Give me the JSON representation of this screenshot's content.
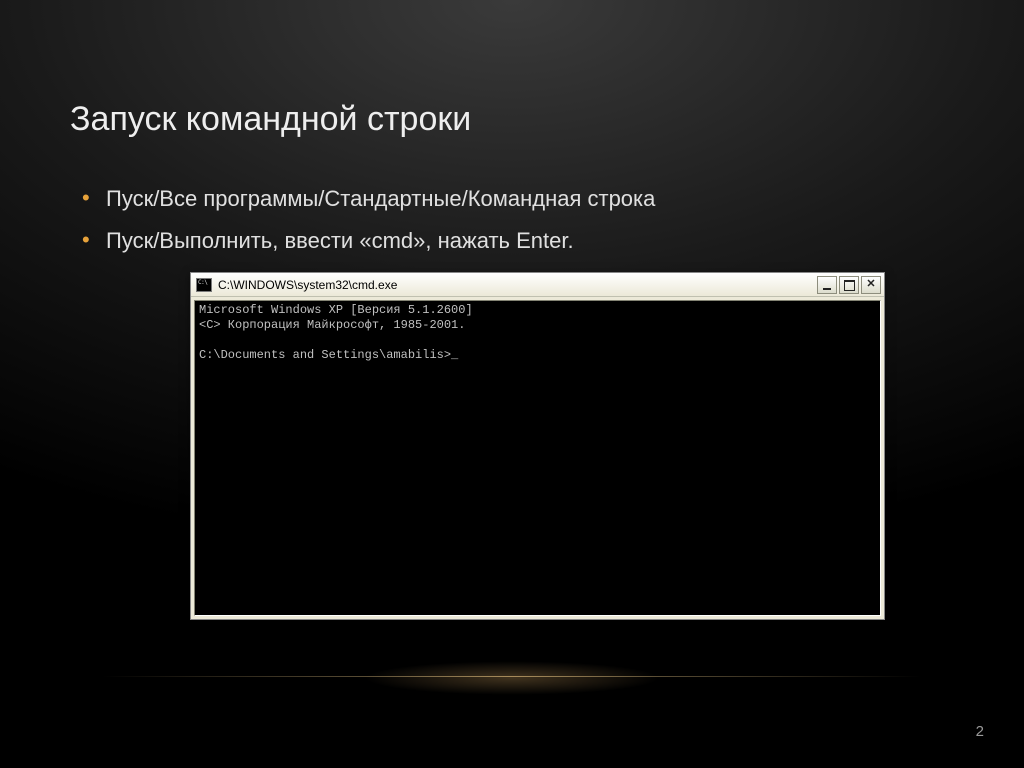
{
  "slide": {
    "title": "Запуск командной строки",
    "bullets": [
      "Пуск/Все программы/Стандартные/Командная строка",
      "Пуск/Выполнить, ввести «cmd», нажать Enter."
    ],
    "page_number": "2"
  },
  "cmd_window": {
    "title": "C:\\WINDOWS\\system32\\cmd.exe",
    "controls": {
      "close_glyph": "✕"
    },
    "terminal": {
      "line1": "Microsoft Windows XP [Версия 5.1.2600]",
      "line2": "<C> Корпорация Майкрософт, 1985-2001.",
      "blank": "",
      "prompt": "C:\\Documents and Settings\\amabilis>",
      "cursor": "_"
    }
  }
}
